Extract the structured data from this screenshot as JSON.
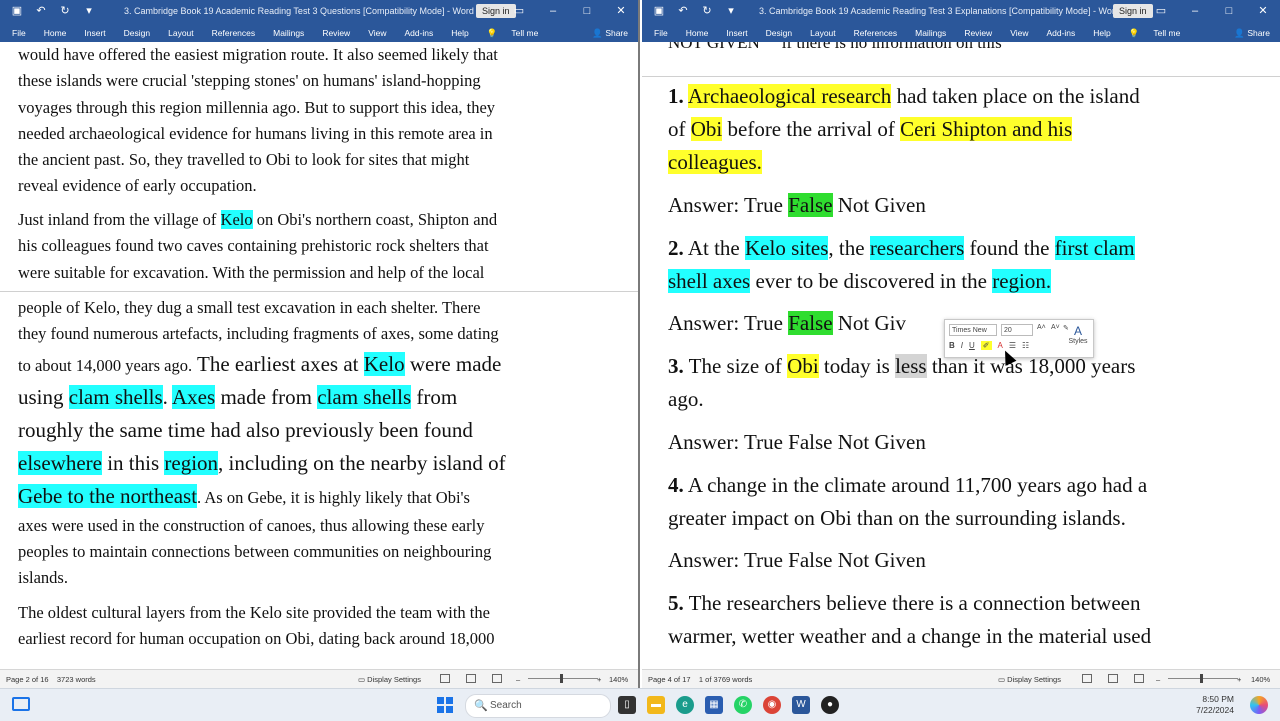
{
  "left": {
    "title": "3. Cambridge Book 19 Academic Reading Test 3 Questions [Compatibility Mode] - Word",
    "signin": "Sign in",
    "tabs": [
      "File",
      "Home",
      "Insert",
      "Design",
      "Layout",
      "References",
      "Mailings",
      "Review",
      "View",
      "Add-ins",
      "Help"
    ],
    "tellme": "Tell me",
    "share": "Share",
    "para1": [
      "would have offered the easiest migration route. It also seemed likely that",
      "these islands were crucial 'stepping stones' on humans' island-hopping",
      "voyages through this region millennia ago. But to support this idea, they",
      "needed archaeological evidence for humans living in this remote area in",
      "the ancient past. So, they travelled to Obi to look for sites that might",
      "reveal evidence of early occupation."
    ],
    "para2": {
      "l1a": "Just inland from the village of ",
      "l1b": "Kelo",
      "l1c": " on Obi's northern coast, Shipton and",
      "l2": "his colleagues found two caves containing prehistoric rock shelters that",
      "l3": "were suitable for excavation. With the permission and help of the local"
    },
    "para3": {
      "l1": "people of Kelo, they dug a small test excavation in each shelter. There",
      "l2": "they found numerous artefacts, including fragments of axes, some dating",
      "l3a": "to about 14,000 years ago.",
      "l3b": " The earliest axes at ",
      "l3c": "Kelo",
      "l3d": " were made",
      "l4a": "using ",
      "l4b": "clam shells",
      "l4c": ". ",
      "l4d": "Axes",
      "l4e": " made from ",
      "l4f": "clam shells",
      "l4g": " from",
      "l5": "roughly the same time had also previously been found",
      "l6a": "elsewhere",
      "l6b": " in this ",
      "l6c": "region",
      "l6d": ", including on the nearby island of",
      "l7a": "Gebe to the northeast",
      "l7b": ". As on Gebe, it is highly likely that Obi's",
      "l8": "axes were used in the construction of canoes, thus allowing these early",
      "l9": "peoples to maintain connections between communities on neighbouring",
      "l10": "islands."
    },
    "para4": {
      "l1": "The oldest cultural layers from the Kelo site provided the team with the",
      "l2": "earliest record for human occupation on Obi, dating back around 18,000"
    },
    "status": {
      "page": "Page 2 of 16",
      "words": "3723 words",
      "display": "Display Settings",
      "zoom": "140%"
    }
  },
  "right": {
    "title": "3. Cambridge Book 19 Academic Reading Test 3 Explanations [Compatibility Mode] - Word",
    "signin": "Sign in",
    "tabs": [
      "File",
      "Home",
      "Insert",
      "Design",
      "Layout",
      "References",
      "Mailings",
      "Review",
      "View",
      "Add-ins",
      "Help"
    ],
    "tellme": "Tell me",
    "share": "Share",
    "topline": {
      "a": "NOT GIVEN",
      "b": "if there is no information on this"
    },
    "q1": {
      "num": "1.",
      "a": "Archaeological research",
      "b": " had taken place on the island",
      "c": "of ",
      "d": "Obi",
      "e": " before the arrival of ",
      "f": "Ceri Shipton and his",
      "g": "colleagues."
    },
    "a1": {
      "pre": "Answer: True ",
      "hl": "False",
      "post": " Not Given"
    },
    "q2": {
      "num": "2.",
      "a": " At the ",
      "b": "Kelo sites",
      "c": ", the ",
      "d": "researchers",
      "e": " found the ",
      "f": "first clam",
      "g": "shell axes",
      "h": " ever to be discovered in the ",
      "i": "region."
    },
    "a2": {
      "pre": "Answer: True ",
      "hl": "False",
      "post": " Not Giv"
    },
    "q3": {
      "num": "3.",
      "a": " The size of ",
      "b": "Obi",
      "c": " today is ",
      "d": "less",
      "e": " than it was 18,000 years",
      "f": "ago."
    },
    "a3": "Answer: True False Not Given",
    "q4": {
      "num": "4.",
      "a": " A change in the climate around 11,700 years ago had a",
      "b": "greater impact on Obi than on the surrounding islands."
    },
    "a4": "Answer: True False Not Given",
    "q5": {
      "num": "5.",
      "a": " The researchers believe there is a connection between",
      "b": "warmer, wetter weather and a change in the material used"
    },
    "minibar": {
      "font": "Times New",
      "size": "20",
      "b": "B",
      "i": "I",
      "u": "U",
      "styles": "Styles"
    },
    "status": {
      "page": "Page 4 of 17",
      "words": "1 of 3769 words",
      "display": "Display Settings",
      "zoom": "140%"
    }
  },
  "taskbar": {
    "search": "Search",
    "time": "8:50 PM",
    "date": "7/22/2024"
  }
}
